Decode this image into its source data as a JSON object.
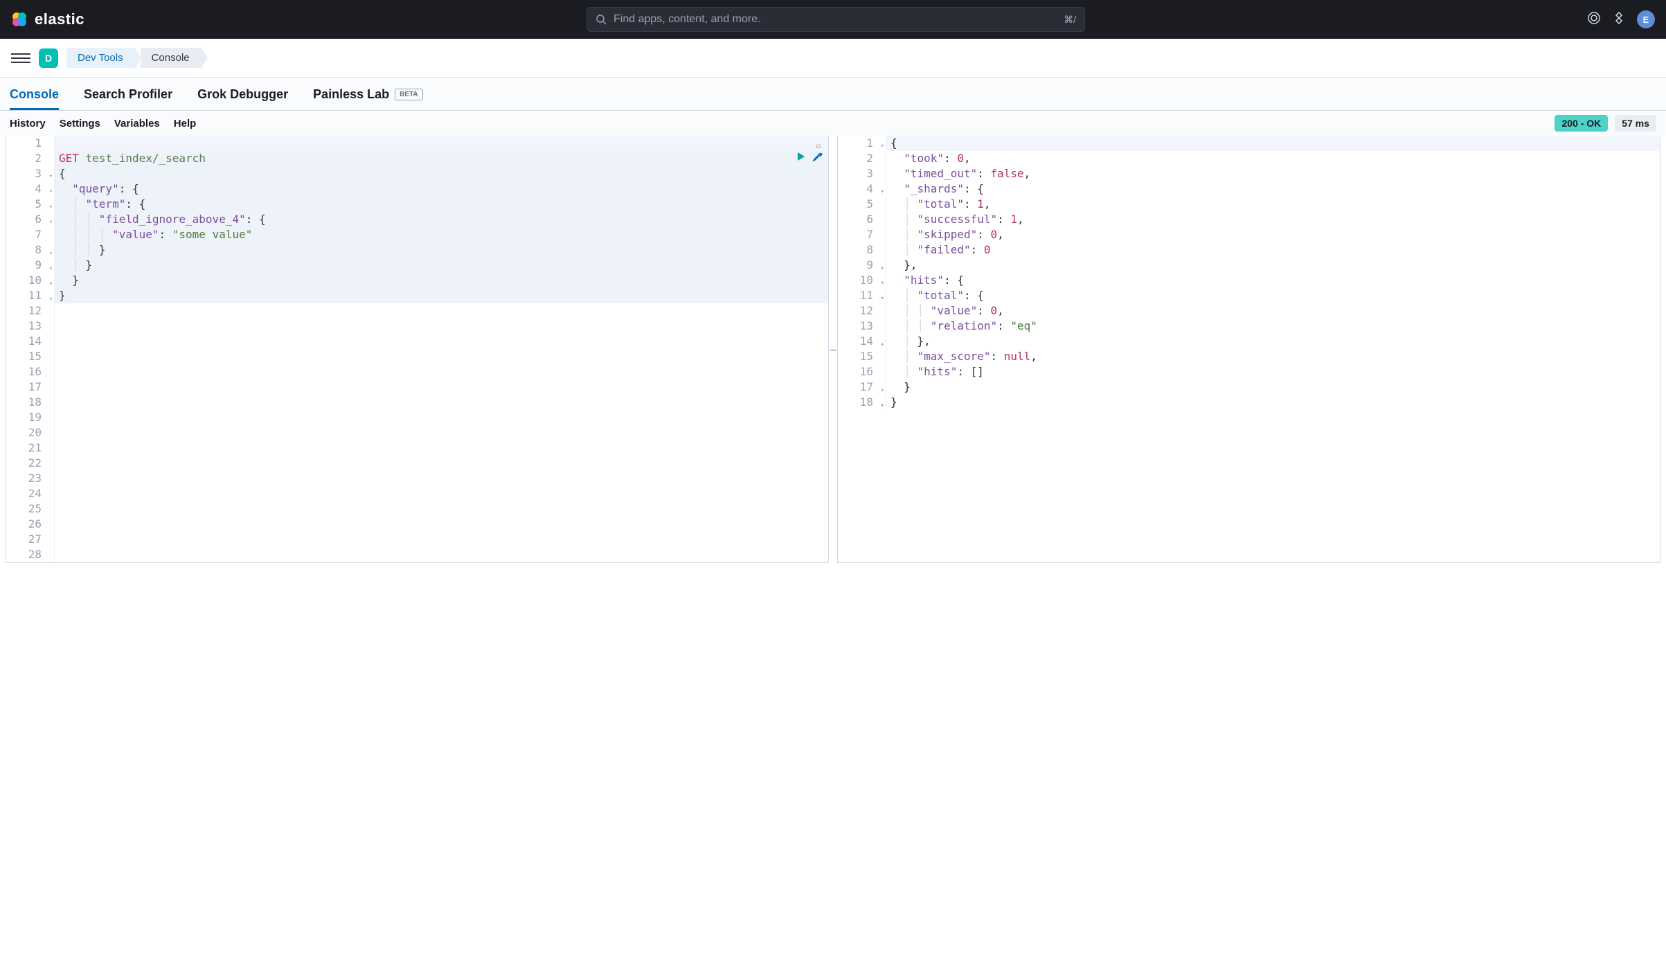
{
  "header": {
    "brand": "elastic",
    "search_placeholder": "Find apps, content, and more.",
    "search_kbd": "⌘/",
    "avatar_initial": "E"
  },
  "crumbs": {
    "deploy_initial": "D",
    "devtools": "Dev Tools",
    "console": "Console"
  },
  "tabs": {
    "console": "Console",
    "profiler": "Search Profiler",
    "grok": "Grok Debugger",
    "painless": "Painless Lab",
    "beta": "BETA"
  },
  "toolbar": {
    "history": "History",
    "settings": "Settings",
    "variables": "Variables",
    "help": "Help"
  },
  "status": {
    "ok": "200 - OK",
    "time": "57 ms"
  },
  "request": {
    "method": "GET",
    "path": "test_index/_search",
    "body_lines": [
      "{",
      "  \"query\": {",
      "    \"term\": {",
      "      \"field_ignore_above_4\": {",
      "        \"value\": \"some value\"",
      "      }",
      "    }",
      "  }",
      "}"
    ]
  },
  "response": {
    "took": 0,
    "timed_out": false,
    "_shards": {
      "total": 1,
      "successful": 1,
      "skipped": 0,
      "failed": 0
    },
    "hits": {
      "total": {
        "value": 0,
        "relation": "eq"
      },
      "max_score": null,
      "hits": []
    }
  },
  "request_gutter": [
    1,
    2,
    3,
    4,
    5,
    6,
    7,
    8,
    9,
    10,
    11,
    12,
    13,
    14,
    15,
    16,
    17,
    18,
    19,
    20,
    21,
    22,
    23,
    24,
    25,
    26,
    27,
    28
  ],
  "request_folds": {
    "3": "down",
    "4": "down",
    "5": "down",
    "6": "down",
    "8": "up",
    "9": "up",
    "10": "up",
    "11": "up"
  },
  "response_gutter": [
    1,
    2,
    3,
    4,
    5,
    6,
    7,
    8,
    9,
    10,
    11,
    12,
    13,
    14,
    15,
    16,
    17,
    18
  ],
  "response_folds": {
    "1": "down",
    "4": "down",
    "9": "up",
    "10": "down",
    "11": "down",
    "14": "up",
    "17": "up",
    "18": "up"
  }
}
